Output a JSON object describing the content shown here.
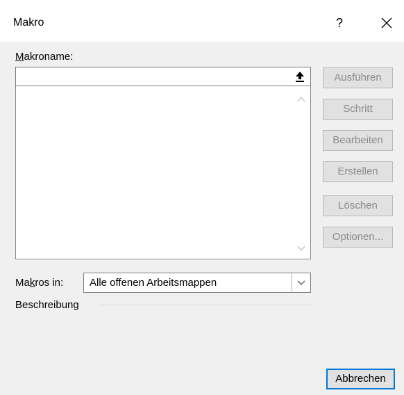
{
  "window": {
    "title": "Makro",
    "help_label": "?",
    "close_icon": "close-icon"
  },
  "macro_name": {
    "label_underlined": "M",
    "label_rest": "akroname:",
    "value": "",
    "upload_icon": "arrow-up-icon"
  },
  "macro_list": {
    "items": [],
    "scroll_up_icon": "chevron-up-icon",
    "scroll_down_icon": "chevron-down-icon"
  },
  "buttons": {
    "run": "Ausführen",
    "step": "Schritt",
    "edit": "Bearbeiten",
    "create": "Erstellen",
    "delete": "Löschen",
    "options": "Optionen...",
    "cancel": "Abbrechen"
  },
  "macros_in": {
    "label_pre": "Ma",
    "label_underlined": "k",
    "label_post": "ros in:",
    "selected": "Alle offenen Arbeitsmappen",
    "arrow_icon": "chevron-down-icon"
  },
  "description": {
    "label": "Beschreibung"
  },
  "colors": {
    "focus_border": "#0078d7",
    "disabled_text": "#8a8a8a",
    "dialog_bg": "#f0f0f0"
  }
}
